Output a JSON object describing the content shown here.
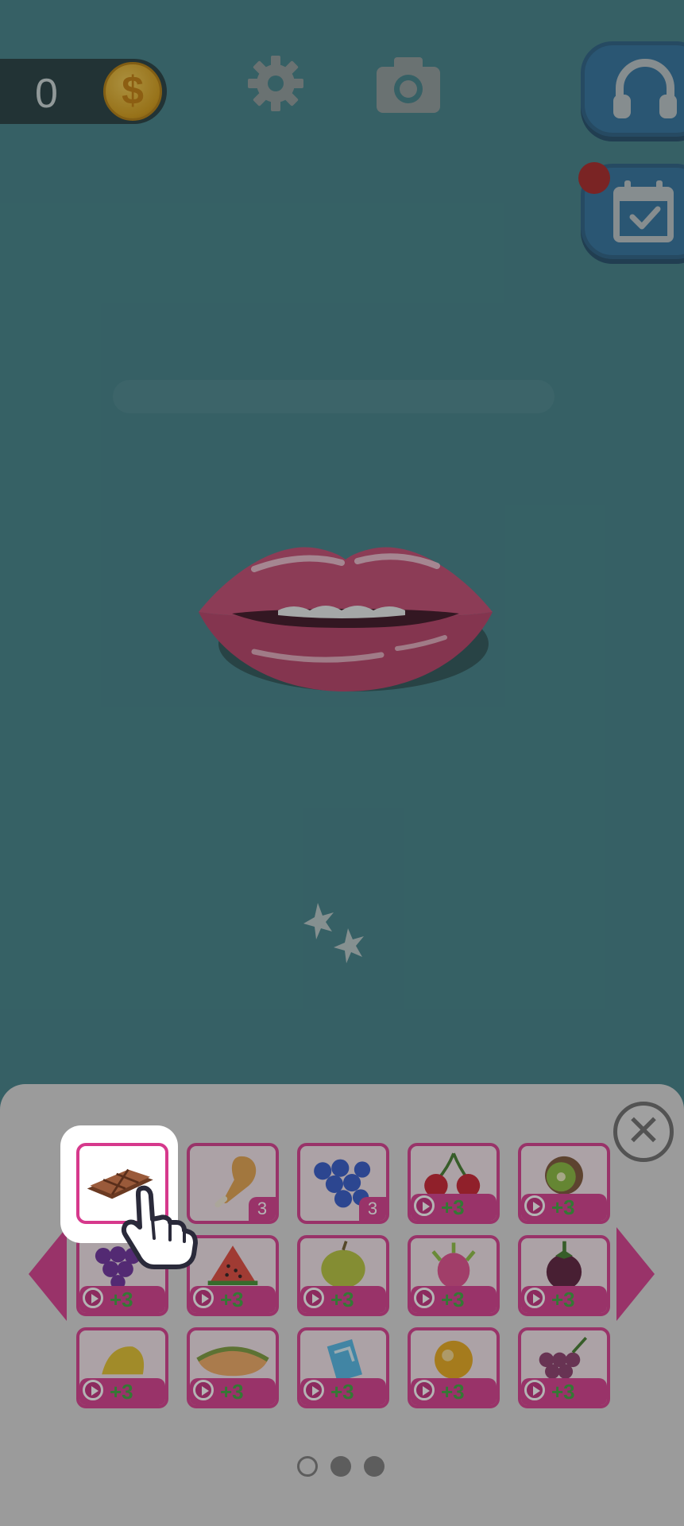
{
  "hud": {
    "coins": "0",
    "coin_symbol": "$",
    "settings_icon": "gear-icon",
    "camera_icon": "camera-icon",
    "support_icon": "headphones-icon",
    "calendar_icon": "calendar-check-icon"
  },
  "progress": {
    "fraction": 0.0
  },
  "panel": {
    "close_symbol": "✕",
    "items": [
      {
        "name": "chocolate",
        "badge": "selected"
      },
      {
        "name": "chicken-leg",
        "badge": "count",
        "count": "3"
      },
      {
        "name": "blueberries",
        "badge": "count",
        "count": "3"
      },
      {
        "name": "cherries",
        "badge": "ad",
        "reward": "+3"
      },
      {
        "name": "kiwi",
        "badge": "ad",
        "reward": "+3"
      },
      {
        "name": "grapes",
        "badge": "ad",
        "reward": "+3"
      },
      {
        "name": "watermelon",
        "badge": "ad",
        "reward": "+3"
      },
      {
        "name": "durian",
        "badge": "ad",
        "reward": "+3"
      },
      {
        "name": "dragon-fruit",
        "badge": "ad",
        "reward": "+3"
      },
      {
        "name": "mangosteen",
        "badge": "ad",
        "reward": "+3"
      },
      {
        "name": "starfruit",
        "badge": "ad",
        "reward": "+3"
      },
      {
        "name": "cantaloupe",
        "badge": "ad",
        "reward": "+3"
      },
      {
        "name": "ice-cube",
        "badge": "ad",
        "reward": "+3"
      },
      {
        "name": "orange",
        "badge": "ad",
        "reward": "+3"
      },
      {
        "name": "red-grapes",
        "badge": "ad",
        "reward": "+3"
      }
    ],
    "page_count": 3,
    "active_page": 1
  },
  "colors": {
    "background": "#3e7f86",
    "accent_pink": "#d6398c",
    "reward_green": "#3da33d",
    "panel": "#d9d9d9"
  }
}
